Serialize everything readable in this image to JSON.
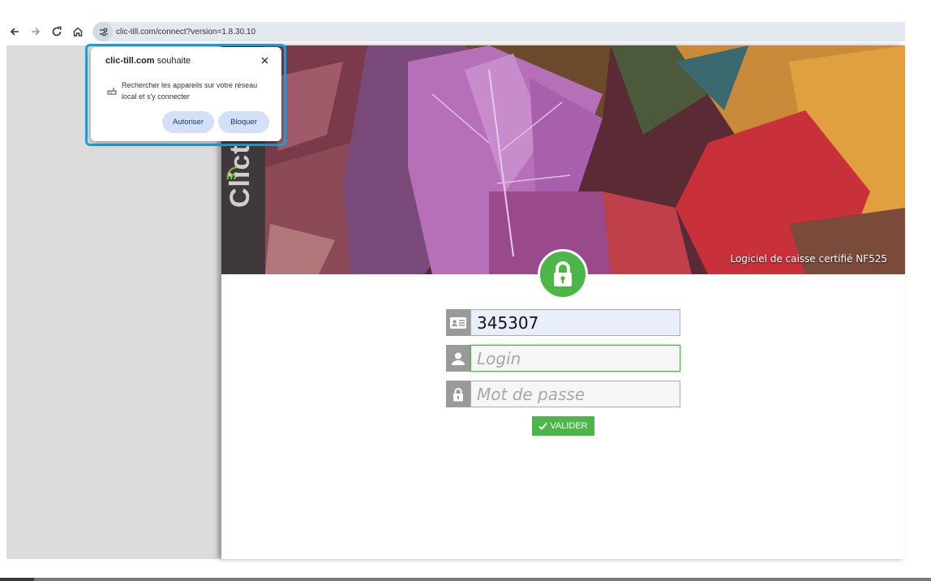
{
  "browser": {
    "url": "clic-till.com/connect?version=1.8.30.10"
  },
  "popup": {
    "site": "clic-till.com",
    "title_suffix": " souhaite",
    "description": "Rechercher les appareils sur votre réseau local et s'y connecter",
    "allow_label": "Autoriser",
    "block_label": "Bloquer"
  },
  "banner": {
    "logo_text": "Clict",
    "tagline": "Logiciel de caisse certifié NF525"
  },
  "form": {
    "account_value": "345307",
    "login_placeholder": "Login",
    "password_placeholder": "Mot de passe",
    "submit_label": "VALIDER"
  },
  "colors": {
    "accent_green": "#4db648",
    "popup_highlight": "#1ea3d8",
    "popup_button": "#d3e0f7"
  },
  "icons": [
    "back-arrow-icon",
    "forward-arrow-icon",
    "reload-icon",
    "home-icon",
    "site-settings-icon",
    "close-icon",
    "network-icon",
    "lock-icon",
    "id-card-icon",
    "user-icon",
    "padlock-icon",
    "check-icon",
    "wifi-icon"
  ]
}
